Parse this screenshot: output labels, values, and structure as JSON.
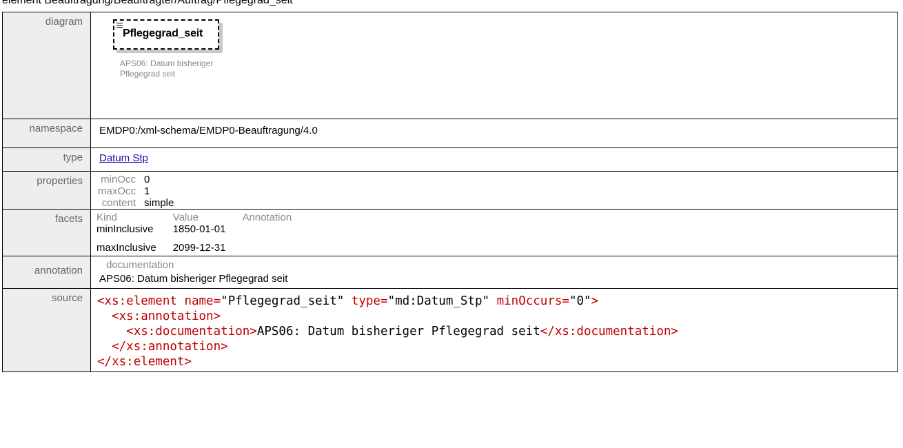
{
  "heading": "element Beauftragung/Beauftragter/Auftrag/Pflegegrad_seit",
  "labels": {
    "diagram": "diagram",
    "namespace": "namespace",
    "type": "type",
    "properties": "properties",
    "facets": "facets",
    "annotation": "annotation",
    "source": "source"
  },
  "diagram": {
    "element_name": "Pflegegrad_seit",
    "documentation": "APS06: Datum bisheriger Pflegegrad seit",
    "icon": "lines-icon"
  },
  "namespace": "EMDP0:/xml-schema/EMDP0-Beauftragung/4.0",
  "type": "Datum Stp",
  "properties": [
    {
      "key": "minOcc",
      "value": "0"
    },
    {
      "key": "maxOcc",
      "value": "1"
    },
    {
      "key": "content",
      "value": "simple"
    }
  ],
  "facets": {
    "headers": [
      "Kind",
      "Value",
      "Annotation"
    ],
    "rows": [
      {
        "kind": "minInclusive",
        "value": "1850-01-01",
        "annotation": ""
      },
      {
        "kind": "maxInclusive",
        "value": "2099-12-31",
        "annotation": ""
      }
    ]
  },
  "annotation": {
    "key": "documentation",
    "text": "APS06: Datum bisheriger Pflegegrad seit"
  },
  "source": {
    "open_tag": "xs:element",
    "attr_name": "name",
    "attr_name_value": "\"Pflegegrad_seit\"",
    "attr_type": "type",
    "attr_type_value": "\"md:Datum_Stp\"",
    "attr_min": "minOccurs",
    "attr_min_value": "\"0\"",
    "annotation_tag": "xs:annotation",
    "doc_tag": "xs:documentation",
    "doc_text": "APS06: Datum bisheriger Pflegegrad seit"
  }
}
